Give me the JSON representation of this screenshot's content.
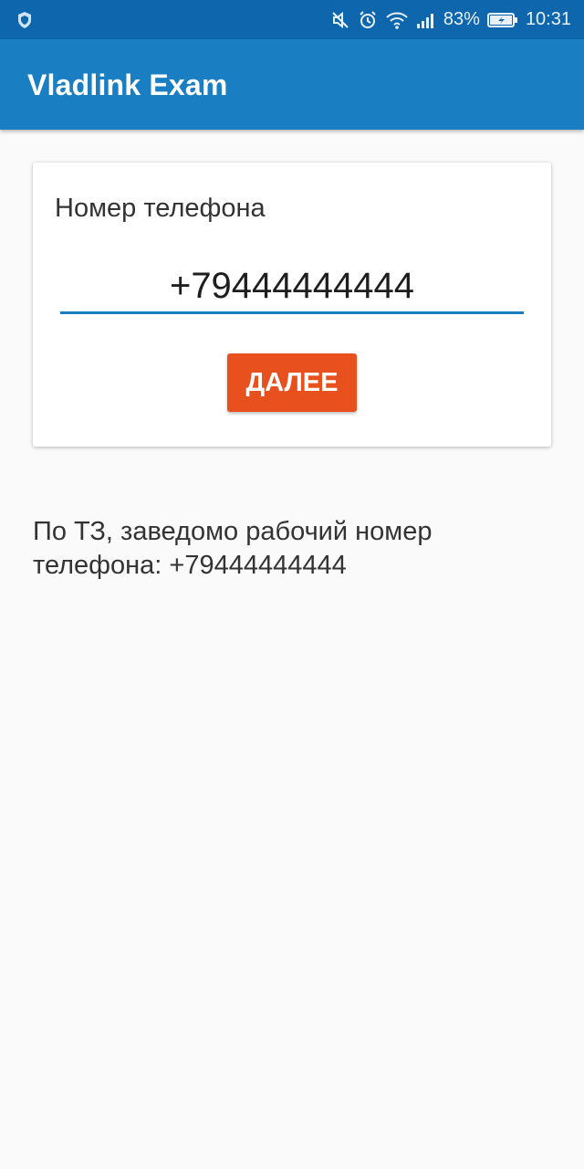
{
  "status_bar": {
    "battery_percent": "83%",
    "time": "10:31"
  },
  "app_bar": {
    "title": "Vladlink Exam"
  },
  "form": {
    "label": "Номер телефона",
    "phone_value": "+79444444444",
    "next_button_label": "ДАЛЕЕ"
  },
  "hint": {
    "text": "По ТЗ, заведомо рабочий номер телефона: +79444444444"
  },
  "colors": {
    "status_bar": "#0e67ad",
    "app_bar": "#1a7ec3",
    "button": "#e8501e",
    "underline": "#1a7ec3"
  },
  "icons": [
    "shield-icon",
    "mute-icon",
    "alarm-icon",
    "wifi-icon",
    "signal-icon",
    "battery-icon"
  ]
}
